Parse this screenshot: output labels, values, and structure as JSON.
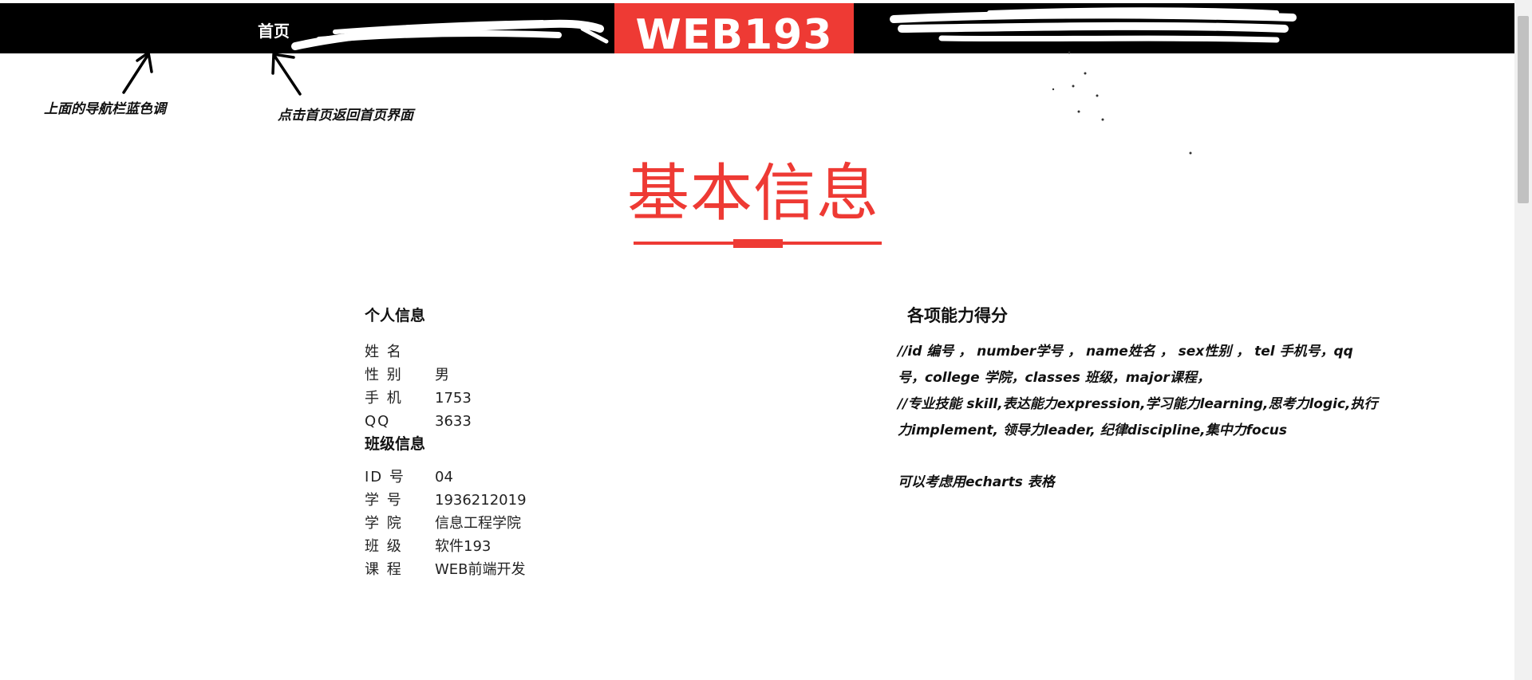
{
  "nav": {
    "home_label": "首页",
    "logo_text": "WEB193"
  },
  "annotations": {
    "nav_color_note": "上面的导航栏蓝色调",
    "home_click_note": "点击首页返回首页界面"
  },
  "section": {
    "title": "基本信息"
  },
  "personal_info": {
    "heading": "个人信息",
    "rows": [
      {
        "label": "姓 名",
        "value": ""
      },
      {
        "label": "性 别",
        "value": "男"
      },
      {
        "label": "手 机",
        "value": "1753"
      },
      {
        "label": "QQ",
        "value": "3633"
      }
    ]
  },
  "class_info": {
    "heading": "班级信息",
    "rows": [
      {
        "label": "ID 号",
        "value": "04"
      },
      {
        "label": "学 号",
        "value": "1936212019"
      },
      {
        "label": "学 院",
        "value": "信息工程学院"
      },
      {
        "label": "班 级",
        "value": "软件193"
      },
      {
        "label": "课 程",
        "value": "WEB前端开发"
      }
    ]
  },
  "abilities": {
    "heading": "各项能力得分",
    "note_lines": [
      "//id 编号 ， number学号 ， name姓名 ， sex性别 ， tel 手机号，qq",
      "号，college 学院，classes 班级，major课程，",
      "//专业技能 skill,表达能力expression,学习能力learning,思考力logic,执行",
      "力implement, 领导力leader, 纪律discipline,集中力focus"
    ],
    "hint": "可以考虑用echarts 表格"
  },
  "colors": {
    "accent": "#ee3a34",
    "nav_bg": "#000000"
  }
}
